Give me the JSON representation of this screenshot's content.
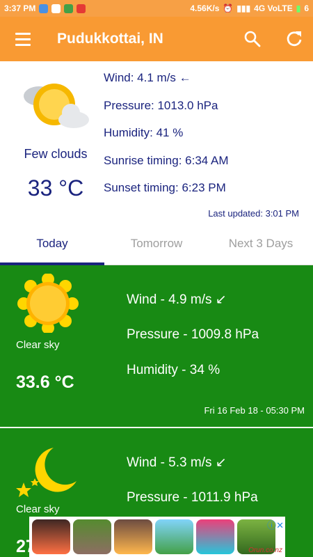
{
  "status_bar": {
    "time": "3:37 PM",
    "speed": "4.56K/s",
    "network": "4G VoLTE",
    "battery": "6"
  },
  "toolbar": {
    "title": "Pudukkottai, IN",
    "menu_icon": "hamburger-menu-icon",
    "search_icon": "search-icon",
    "refresh_icon": "refresh-icon"
  },
  "current": {
    "icon": "sun-behind-cloud-icon",
    "description": "Few clouds",
    "temperature": "33 °C",
    "wind": "Wind: 4.1 m/s ←",
    "pressure": "Pressure: 1013.0 hPa",
    "humidity": "Humidity: 41 %",
    "sunrise": "Sunrise timing: 6:34 AM",
    "sunset": "Sunset timing: 6:23 PM",
    "last_updated": "Last updated: 3:01 PM"
  },
  "tabs": [
    {
      "label": "Today",
      "active": true
    },
    {
      "label": "Tomorrow",
      "active": false
    },
    {
      "label": "Next 3 Days",
      "active": false
    }
  ],
  "forecast": [
    {
      "icon": "sun-icon",
      "description": "Clear sky",
      "temperature": "33.6 °C",
      "wind": "Wind - 4.9 m/s ↙",
      "pressure": "Pressure - 1009.8 hPa",
      "humidity": "Humidity - 34 %",
      "date": "Fri 16 Feb 18 - 05:30 PM"
    },
    {
      "icon": "moon-stars-icon",
      "description": "Clear sky",
      "temperature": "27",
      "wind": "Wind - 5.3 m/s ↙",
      "pressure": "Pressure - 1011.9 hPa"
    }
  ],
  "ad": {
    "watermark": "Orun.co.nz",
    "close_icon": "ad-info-close-icon"
  },
  "colors": {
    "toolbar": "#f99a33",
    "forecast_bg": "#188a14",
    "text_primary": "#1a237e"
  }
}
